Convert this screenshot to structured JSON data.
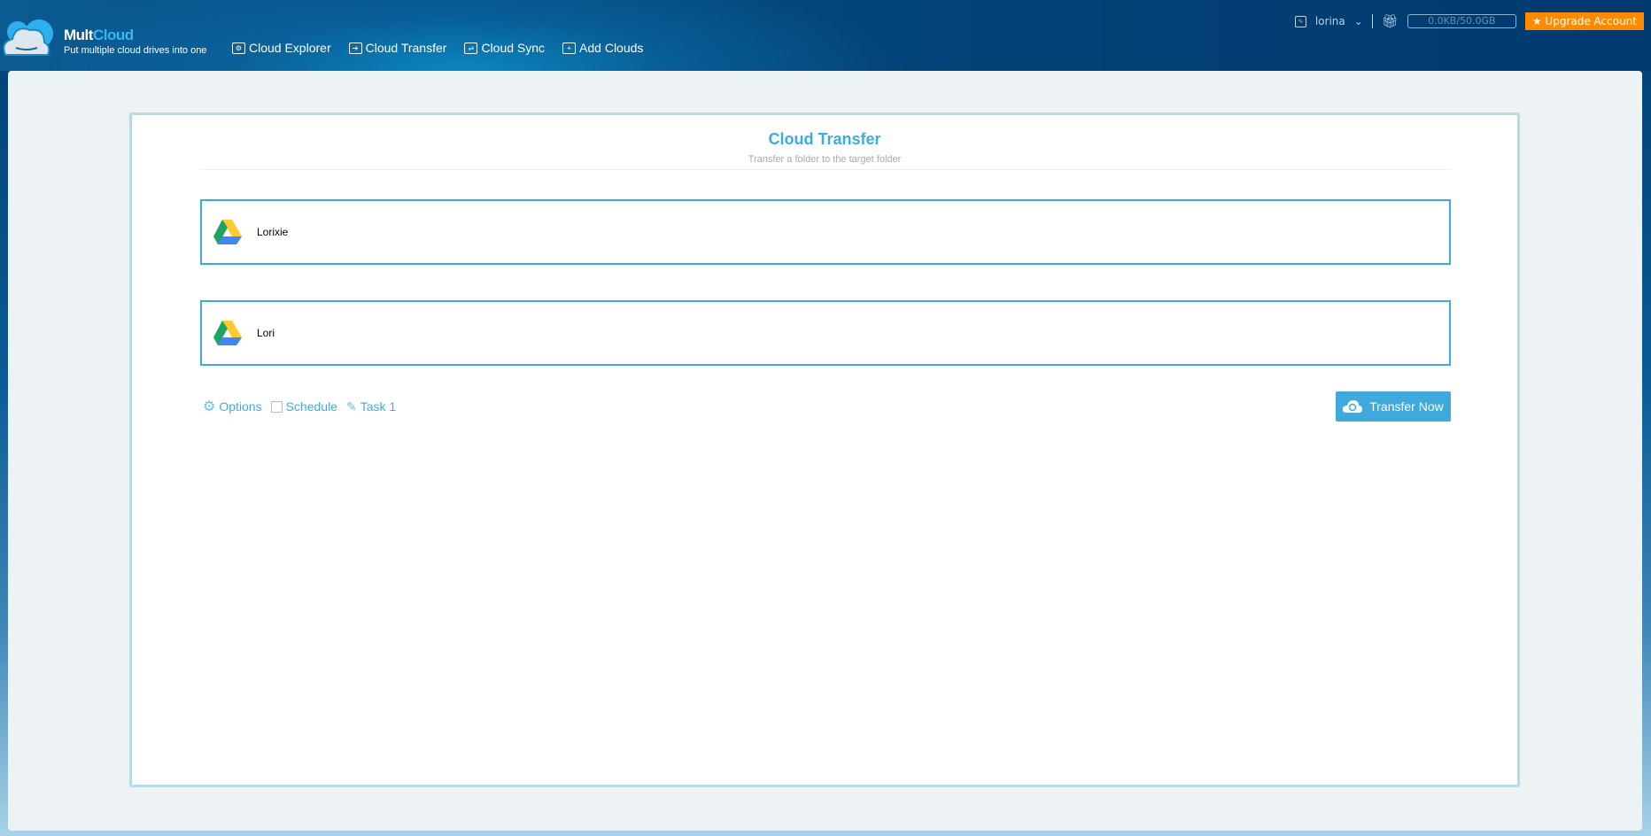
{
  "header": {
    "brand_a": "Mult",
    "brand_b": "Cloud",
    "tagline": "Put multiple cloud drives into one",
    "nav": [
      {
        "label": "Cloud Explorer",
        "icon": "folder-gear-icon"
      },
      {
        "label": "Cloud Transfer",
        "icon": "folder-arrow-icon"
      },
      {
        "label": "Cloud Sync",
        "icon": "folder-sync-icon"
      },
      {
        "label": "Add Clouds",
        "icon": "folder-plus-icon"
      }
    ],
    "user": "lorina",
    "storage": "0.0KB/50.0GB",
    "upgrade": "★ Upgrade Account"
  },
  "main": {
    "title": "Cloud Transfer",
    "subtitle": "Transfer a folder to the target folder",
    "source": "Lorixie",
    "target": "Lori",
    "options": "Options",
    "schedule": "Schedule",
    "task": "Task 1",
    "transfer_button": "Transfer Now"
  },
  "colors": {
    "accent": "#3fa9dc",
    "upgrade": "#ff8a00"
  }
}
